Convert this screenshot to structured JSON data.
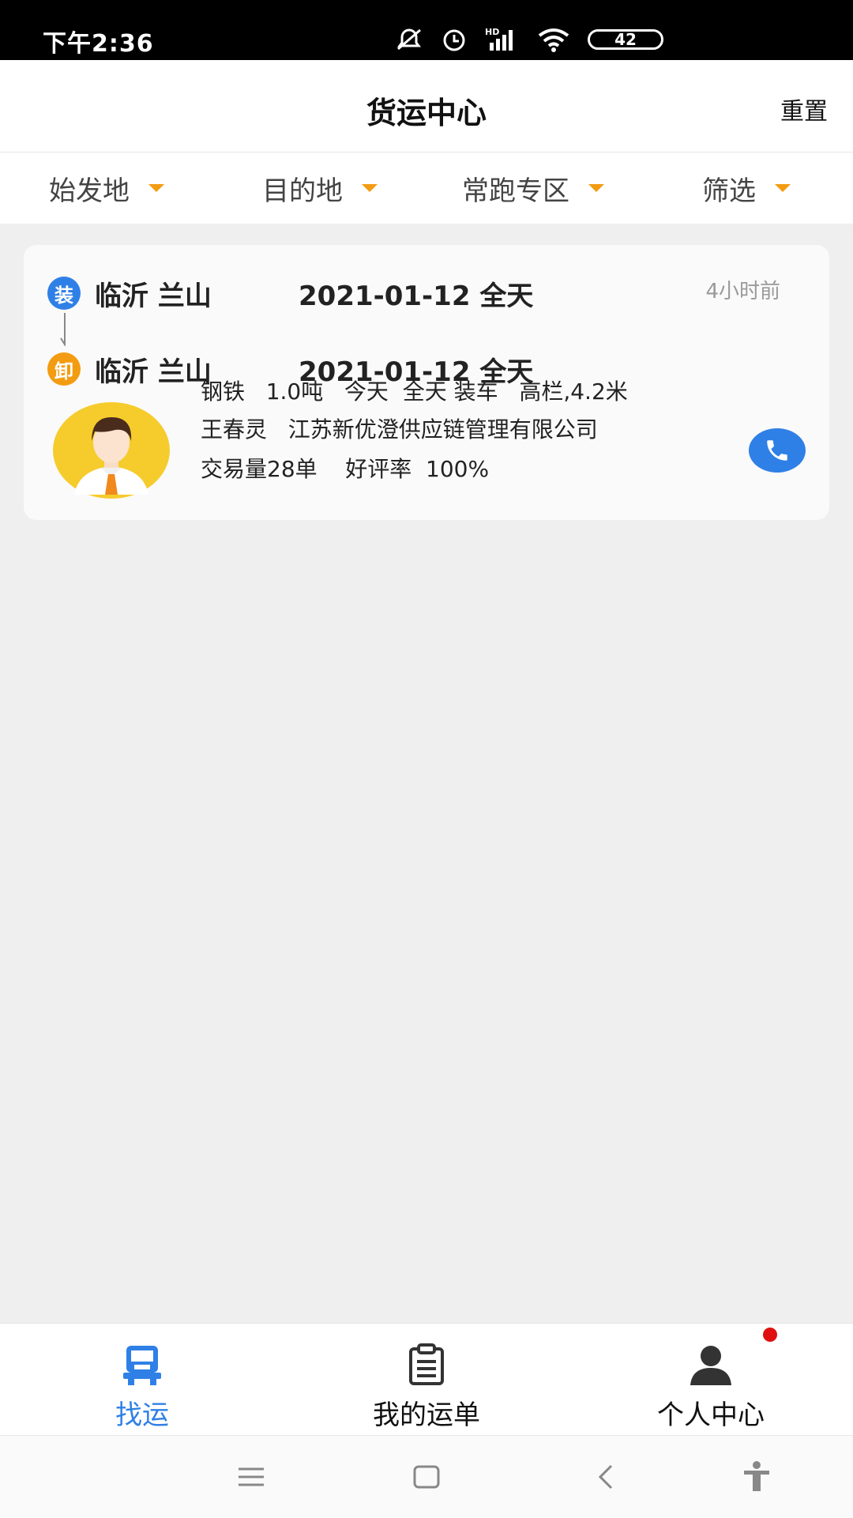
{
  "status_bar": {
    "time": "下午2:36",
    "battery": "42",
    "icons": [
      "mute-bell-icon",
      "alarm-icon",
      "hd-signal-icon",
      "wifi-icon",
      "battery-icon"
    ]
  },
  "header": {
    "title": "货运中心",
    "reset": "重置"
  },
  "filters": [
    {
      "label": "始发地"
    },
    {
      "label": "目的地"
    },
    {
      "label": "常跑专区"
    },
    {
      "label": "筛选"
    }
  ],
  "card": {
    "load": {
      "badge": "装",
      "city": "临沂 兰山",
      "date": "2021-01-12 全天"
    },
    "unload": {
      "badge": "卸",
      "city": "临沂 兰山",
      "date": "2021-01-12 全天"
    },
    "posted": "4小时前",
    "cargo": "钢铁   1.0吨   今天  全天 装车   高栏,4.2米",
    "shipper": "王春灵   江苏新优澄供应链管理有限公司",
    "stats": "交易量28单    好评率  100%"
  },
  "tabbar": {
    "items": [
      {
        "label": "找运",
        "active": true
      },
      {
        "label": "我的运单"
      },
      {
        "label": "个人中心"
      }
    ]
  },
  "colors": {
    "accent": "#2f80e6",
    "orange": "#f39c12",
    "badge_dot": "#e01010"
  }
}
